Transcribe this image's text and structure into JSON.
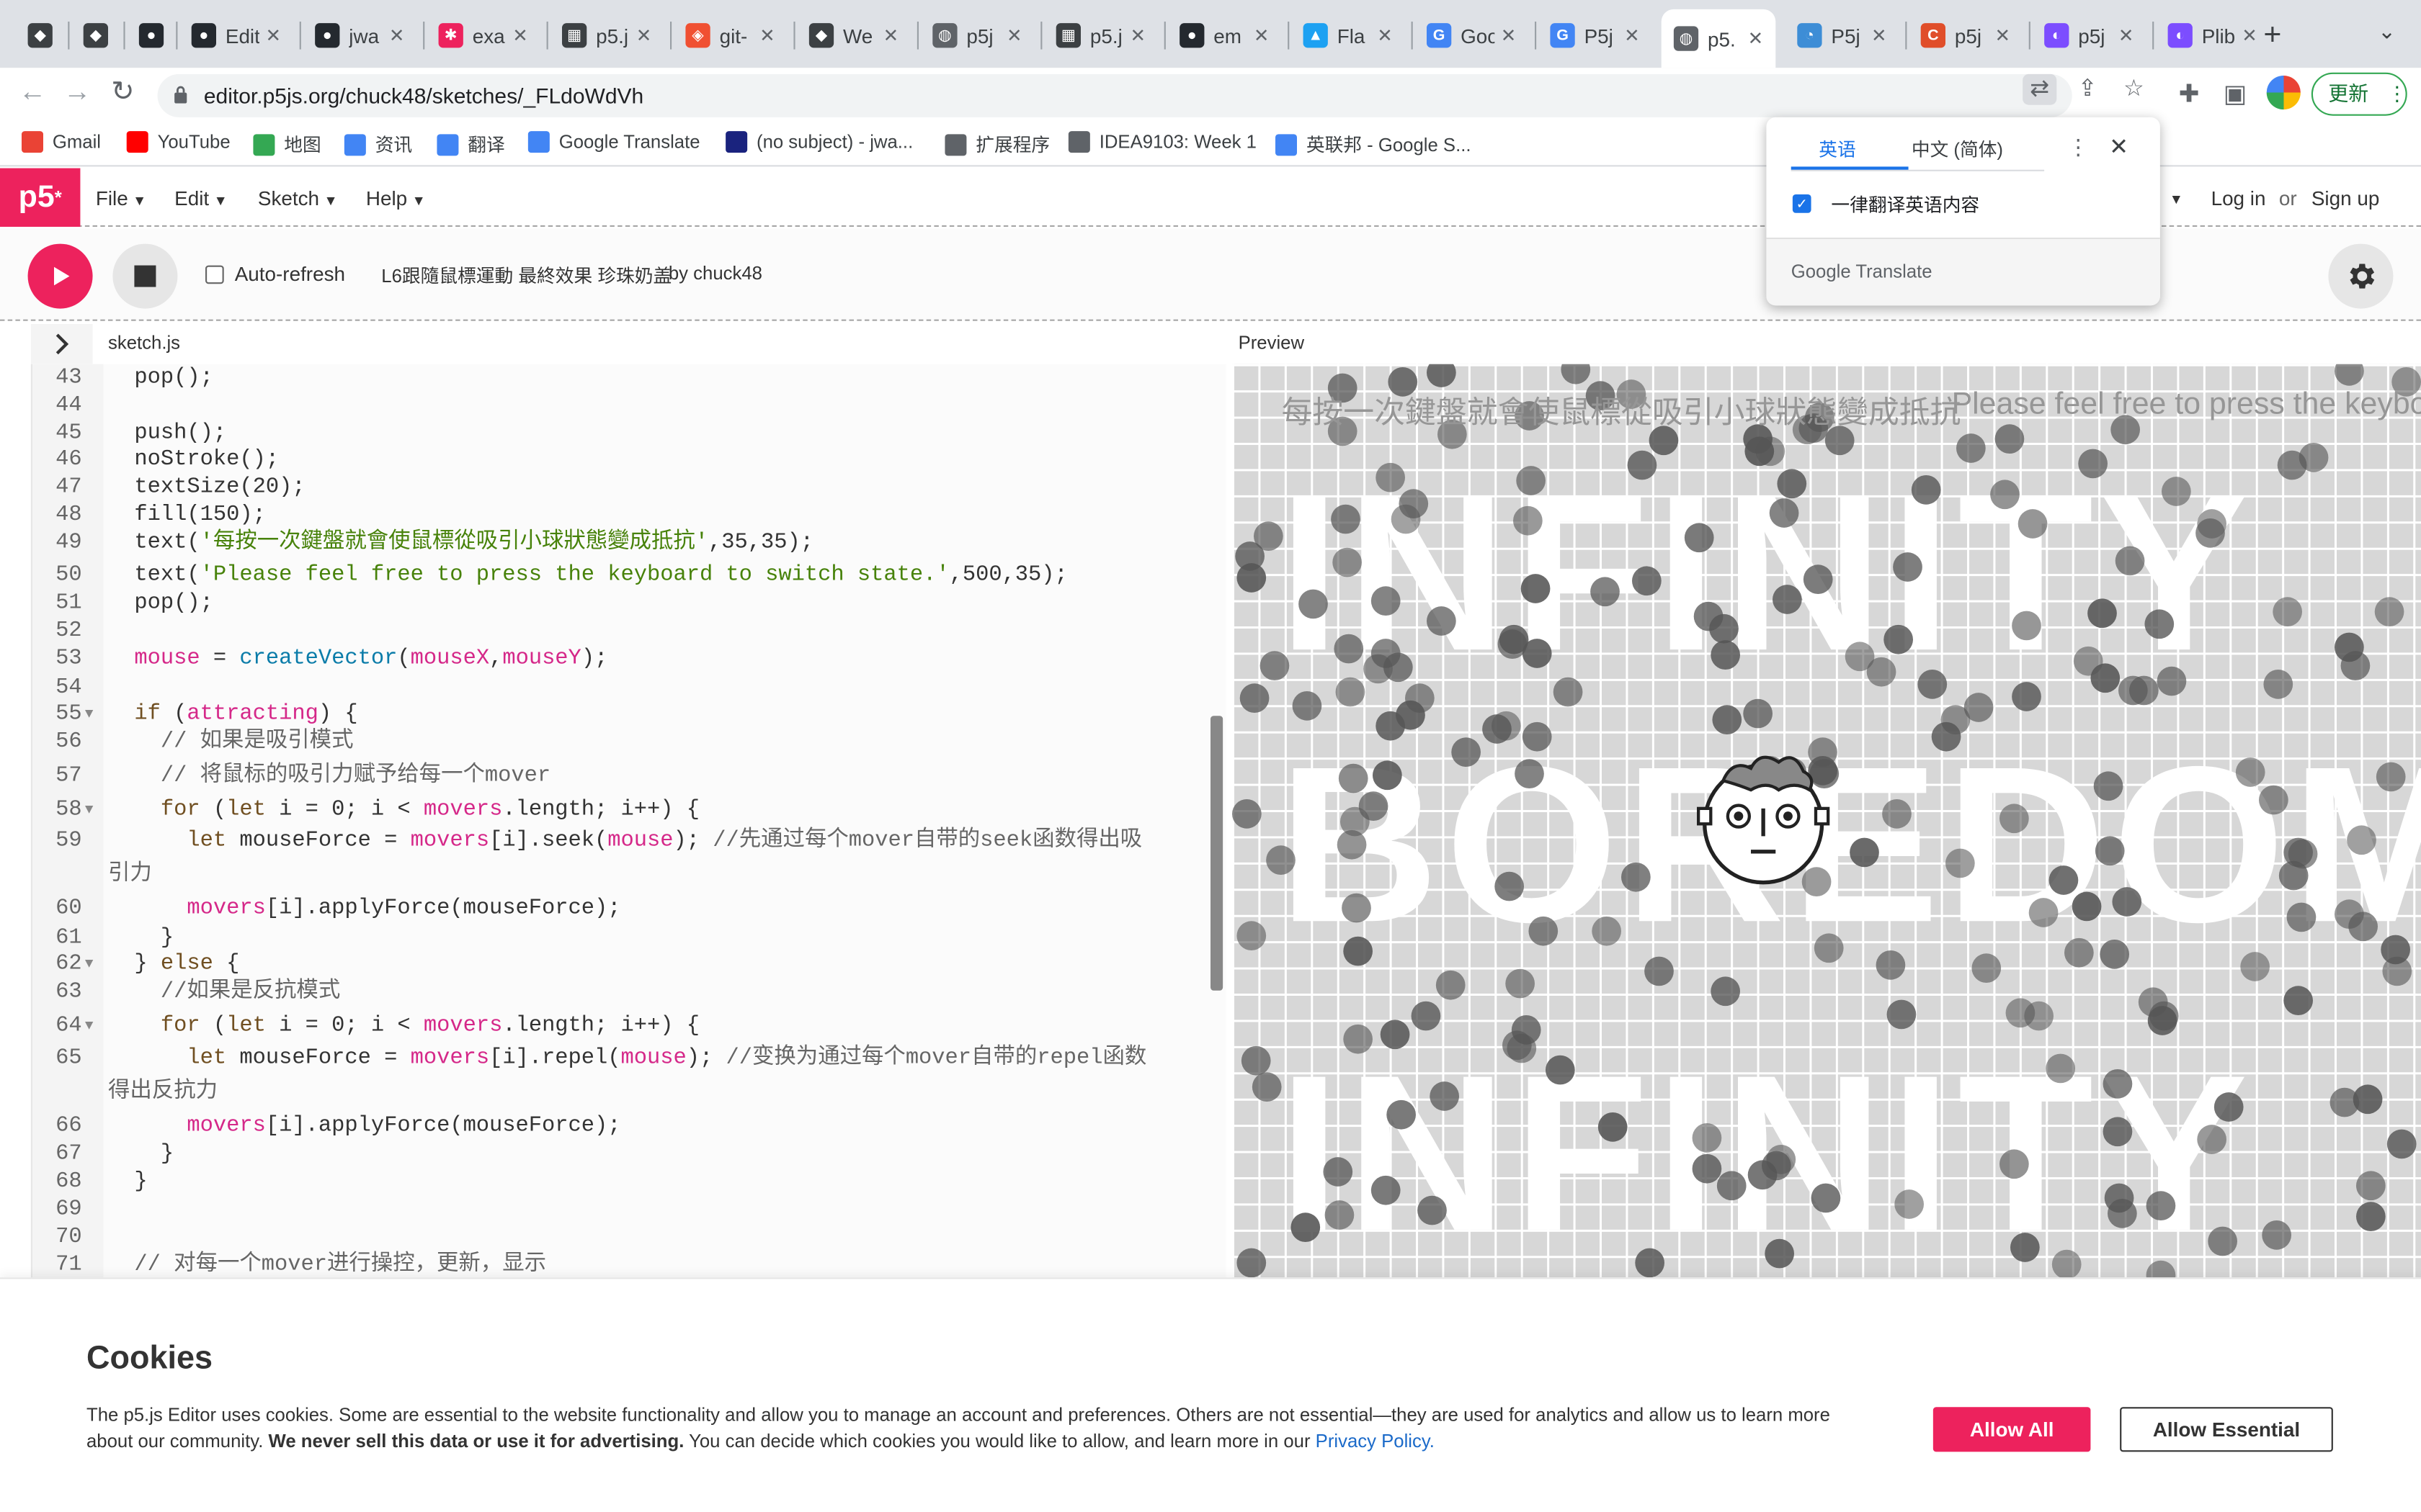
{
  "browser": {
    "tabs": [
      {
        "title": "",
        "icon": "shield-icon",
        "color": "#3c4043"
      },
      {
        "title": "",
        "icon": "shield-icon",
        "color": "#3c4043"
      },
      {
        "title": "",
        "icon": "github-icon",
        "color": "#24292f"
      },
      {
        "title": "Edit",
        "icon": "github-icon",
        "color": "#24292f"
      },
      {
        "title": "jwa",
        "icon": "github-icon",
        "color": "#24292f"
      },
      {
        "title": "exa",
        "icon": "asterisk-icon",
        "color": "#ed225d"
      },
      {
        "title": "p5.j",
        "icon": "grid-icon",
        "color": "#3c4043"
      },
      {
        "title": "git-",
        "icon": "git-icon",
        "color": "#f05032"
      },
      {
        "title": "We",
        "icon": "shield-icon",
        "color": "#3c4043"
      },
      {
        "title": "p5j",
        "icon": "globe-icon",
        "color": "#5f6368"
      },
      {
        "title": "p5.j",
        "icon": "grid-icon",
        "color": "#3c4043"
      },
      {
        "title": "em",
        "icon": "github-icon",
        "color": "#24292f"
      },
      {
        "title": "Fla",
        "icon": "flap-icon",
        "color": "#1da1f2"
      },
      {
        "title": "Goo",
        "icon": "translate-icon",
        "color": "#4285f4"
      },
      {
        "title": "P5j",
        "icon": "google-icon",
        "color": "#4285f4"
      },
      {
        "title": "p5.",
        "icon": "globe-icon",
        "color": "#5f6368"
      },
      {
        "title": "P5j",
        "icon": "bird-icon",
        "color": "#3d8dd6"
      },
      {
        "title": "p5j",
        "icon": "c-icon",
        "color": "#e04e2a"
      },
      {
        "title": "p5j",
        "icon": "gradient-icon",
        "color": "#7c4dff"
      },
      {
        "title": "Plib",
        "icon": "gradient-icon",
        "color": "#7c4dff"
      }
    ],
    "url": "editor.p5js.org/chuck48/sketches/_FLdoWdVh",
    "update_label": "更新",
    "bookmarks": [
      {
        "label": "Gmail",
        "color": "#ea4335"
      },
      {
        "label": "YouTube",
        "color": "#ff0000"
      },
      {
        "label": "地图",
        "color": "#34a853"
      },
      {
        "label": "资讯",
        "color": "#4285f4"
      },
      {
        "label": "翻译",
        "color": "#4285f4"
      },
      {
        "label": "Google Translate",
        "color": "#4285f4"
      },
      {
        "label": "(no subject) - jwa...",
        "color": "#1a237e"
      },
      {
        "label": "扩展程序",
        "color": "#5f6368"
      },
      {
        "label": "IDEA9103: Week 1",
        "color": "#5f6368"
      },
      {
        "label": "英联邦 - Google S...",
        "color": "#4285f4"
      }
    ]
  },
  "p5": {
    "logo": "p5",
    "menus": [
      "File",
      "Edit",
      "Sketch",
      "Help"
    ],
    "login": "Log in",
    "or": "or",
    "signup": "Sign up",
    "auto_refresh": "Auto-refresh",
    "sketch_name": "L6跟隨鼠標運動 最終效果 珍珠奶盖",
    "by": "by chuck48",
    "file_tab": "sketch.js",
    "preview_label": "Preview"
  },
  "code": [
    {
      "n": "43",
      "t": "pop();"
    },
    {
      "n": "44",
      "t": ""
    },
    {
      "n": "45",
      "t": "push();"
    },
    {
      "n": "46",
      "t": "noStroke();"
    },
    {
      "n": "47",
      "t": "textSize(20);"
    },
    {
      "n": "48",
      "t": "fill(150);"
    },
    {
      "n": "49",
      "t": "text('每按一次鍵盤就會使鼠標從吸引小球狀態變成抵抗',35,35);"
    },
    {
      "n": "50",
      "t": "text('Please feel free to press the keyboard to switch state.',500,35);"
    },
    {
      "n": "51",
      "t": "pop();"
    },
    {
      "n": "52",
      "t": ""
    },
    {
      "n": "53",
      "t": "mouse = createVector(mouseX,mouseY);"
    },
    {
      "n": "54",
      "t": ""
    },
    {
      "n": "55",
      "t": "if (attracting) {"
    },
    {
      "n": "56",
      "t": "  // 如果是吸引模式"
    },
    {
      "n": "57",
      "t": "  // 将鼠标的吸引力赋予给每一个mover"
    },
    {
      "n": "58",
      "t": "  for (let i = 0; i < movers.length; i++) {"
    },
    {
      "n": "59",
      "t": "    let mouseForce = movers[i].seek(mouse); //先通过每个mover自带的seek函数得出吸"
    },
    {
      "n": "",
      "t": "引力"
    },
    {
      "n": "60",
      "t": "    movers[i].applyForce(mouseForce);"
    },
    {
      "n": "61",
      "t": "  }"
    },
    {
      "n": "62",
      "t": "} else {"
    },
    {
      "n": "63",
      "t": "  //如果是反抗模式"
    },
    {
      "n": "64",
      "t": "  for (let i = 0; i < movers.length; i++) {"
    },
    {
      "n": "65",
      "t": "    let mouseForce = movers[i].repel(mouse); //变换为通过每个mover自带的repel函数"
    },
    {
      "n": "",
      "t": "得出反抗力"
    },
    {
      "n": "66",
      "t": "    movers[i].applyForce(mouseForce);"
    },
    {
      "n": "67",
      "t": "  }"
    },
    {
      "n": "68",
      "t": "}"
    },
    {
      "n": "69",
      "t": ""
    },
    {
      "n": "70",
      "t": ""
    },
    {
      "n": "71",
      "t": "// 对每一个mover进行操控，更新，显示"
    }
  ],
  "preview": {
    "line_cn": "每按一次鍵盤就會使鼠標從吸引小球狀態變成抵抗",
    "line_en": "Please feel free to press the keyboard to switch state.",
    "word_top": "INFINITY",
    "word_mid": "BOREDOM",
    "word_bottom": "INFINITY"
  },
  "translate_popup": {
    "tab_en": "英语",
    "tab_zh": "中文 (简体)",
    "always_label": "一律翻译英语内容",
    "brand_google": "Google",
    "brand_translate": "Translate"
  },
  "cookies": {
    "title": "Cookies",
    "body_1": "The p5.js Editor uses cookies. Some are essential to the website functionality and allow you to manage an account and preferences. Others are not essential—they are used for analytics and allow us to learn more about our community.",
    "body_bold": "We never sell this data or use it for advertising.",
    "body_2": "You can decide which cookies you would like to allow, and learn more in our",
    "privacy_link": "Privacy Policy.",
    "allow_all": "Allow All",
    "allow_essential": "Allow Essential"
  },
  "colors": {
    "p5_pink": "#ed225d",
    "link_blue": "#1b6ac9",
    "google_blue": "#1a73e8"
  }
}
